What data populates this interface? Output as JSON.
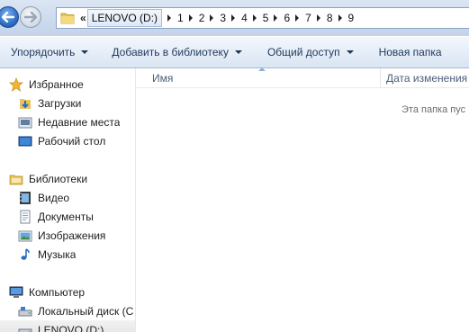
{
  "address": {
    "overflow": "«",
    "crumbs": [
      "LENOVO (D:)",
      "1",
      "2",
      "3",
      "4",
      "5",
      "6",
      "7",
      "8",
      "9"
    ]
  },
  "toolbar": {
    "organize": "Упорядочить",
    "add_library": "Добавить в библиотеку",
    "share": "Общий доступ",
    "new_folder": "Новая папка"
  },
  "nav": {
    "favorites": "Избранное",
    "downloads": "Загрузки",
    "recent": "Недавние места",
    "desktop": "Рабочий стол",
    "libraries": "Библиотеки",
    "video": "Видео",
    "documents": "Документы",
    "pictures": "Изображения",
    "music": "Музыка",
    "computer": "Компьютер",
    "local_disk": "Локальный диск (C",
    "lenovo": "LENOVO (D:)"
  },
  "columns": {
    "name": "Имя",
    "date": "Дата изменения"
  },
  "empty_message": "Эта папка пус",
  "colors": {
    "toolbar_text": "#1e395b",
    "accent_blue": "#2f6fc6"
  }
}
